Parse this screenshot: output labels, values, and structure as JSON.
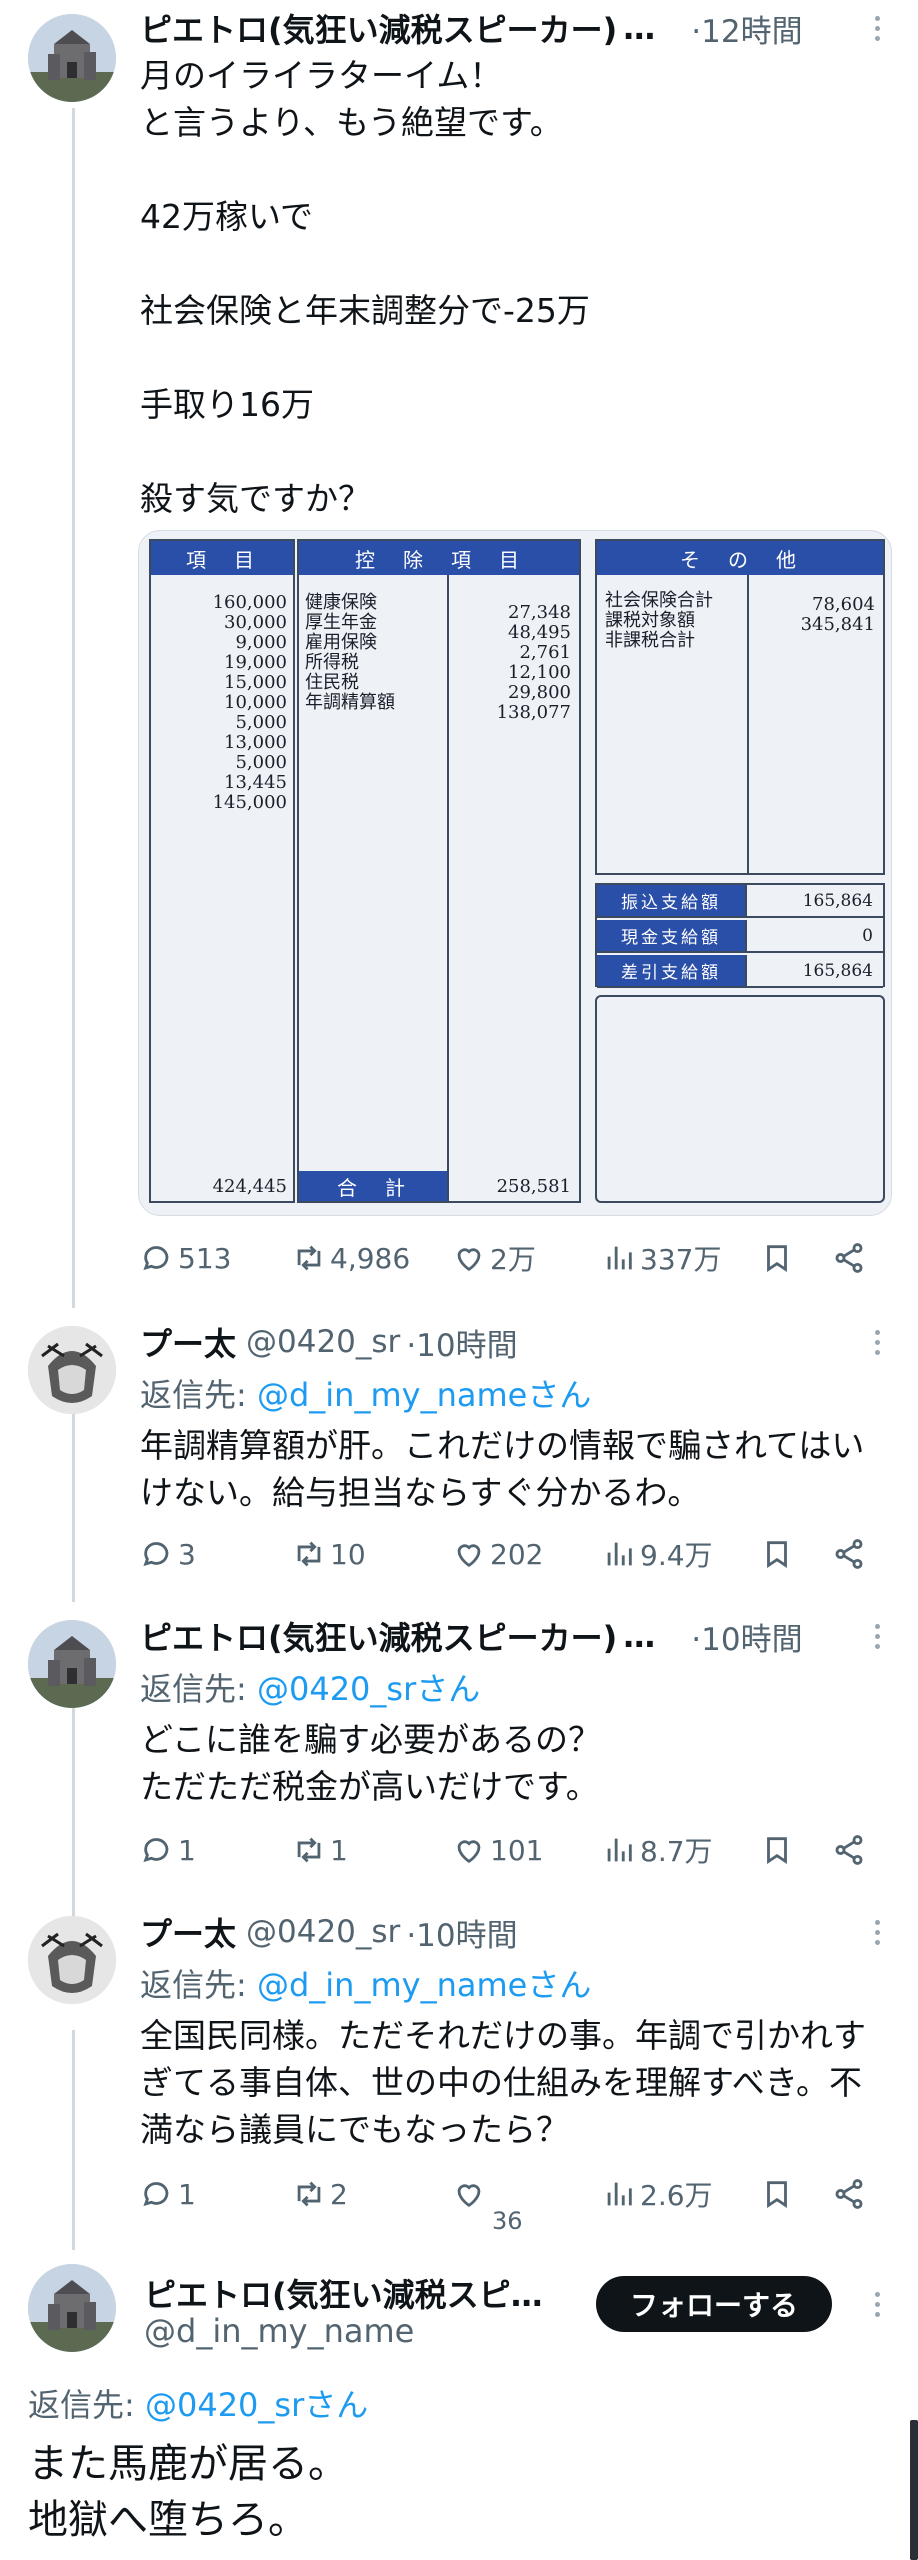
{
  "posts": [
    {
      "name": "ピエトロ(気狂い減税スピーカー)",
      "truncated": "…",
      "time": "·12時間",
      "body": "月のイライラターイム！\nと言うより、もう絶望です。\n\n42万稼いで\n\n社会保険と年末調整分で-25万\n\n手取り16万\n\n殺す気ですか？",
      "stats": {
        "replies": "513",
        "reposts": "4,986",
        "likes": "2万",
        "views": "337万"
      }
    },
    {
      "name": "プー太",
      "handle": "@0420_sr",
      "time": "·10時間",
      "reply_prefix": "返信先: ",
      "reply_to": "@d_in_my_nameさん",
      "body": "年調精算額が肝。これだけの情報で騙されてはい\nけない。給与担当ならすぐ分かるわ。",
      "stats": {
        "replies": "3",
        "reposts": "10",
        "likes": "202",
        "views": "9.4万"
      }
    },
    {
      "name": "ピエトロ(気狂い減税スピーカー)",
      "truncated": "…",
      "time": "·10時間",
      "reply_prefix": "返信先: ",
      "reply_to": "@0420_srさん",
      "body": "どこに誰を騙す必要があるの？\nただただ税金が高いだけです。",
      "stats": {
        "replies": "1",
        "reposts": "1",
        "likes": "101",
        "views": "8.7万"
      }
    },
    {
      "name": "プー太",
      "handle": "@0420_sr",
      "time": "·10時間",
      "reply_prefix": "返信先: ",
      "reply_to": "@d_in_my_nameさん",
      "body": "全国民同様。ただそれだけの事。年調で引かれす\nぎてる事自体、世の中の仕組みを理解すべき。不\n満なら議員にでもなったら？",
      "stats": {
        "replies": "1",
        "reposts": "2",
        "likes": "36",
        "views": "2.6万"
      }
    }
  ],
  "focus": {
    "name": "ピエトロ(気狂い減税スピ…",
    "handle": "@d_in_my_name",
    "follow_label": "フォローする",
    "reply_prefix": "返信先: ",
    "reply_to": "@0420_srさん",
    "body": "また馬鹿が居る。\n地獄へ堕ちろ。"
  },
  "payslip": {
    "headers": {
      "items": "項　目",
      "deduction": "控　除　項　目",
      "other": "そ　の　他",
      "total": "合　計"
    },
    "payments": "160,000\n30,000\n9,000\n19,000\n15,000\n10,000\n5,000\n13,000\n5,000\n13,445\n145,000",
    "deduction_names": "健康保険\n厚生年金\n雇用保険\n所得税\n住民税\n年調精算額",
    "deduction_values": "27,348\n48,495\n2,761\n12,100\n29,800\n138,077",
    "other_names": "社会保険合計\n課税対象額\n非課税合計",
    "other_values": "78,604\n345,841",
    "pay_rows": [
      {
        "label": "振込支給額",
        "value": "165,864"
      },
      {
        "label": "現金支給額",
        "value": "0"
      },
      {
        "label": "差引支給額",
        "value": "165,864"
      }
    ],
    "payment_total": "424,445",
    "deduction_total": "258,581"
  }
}
